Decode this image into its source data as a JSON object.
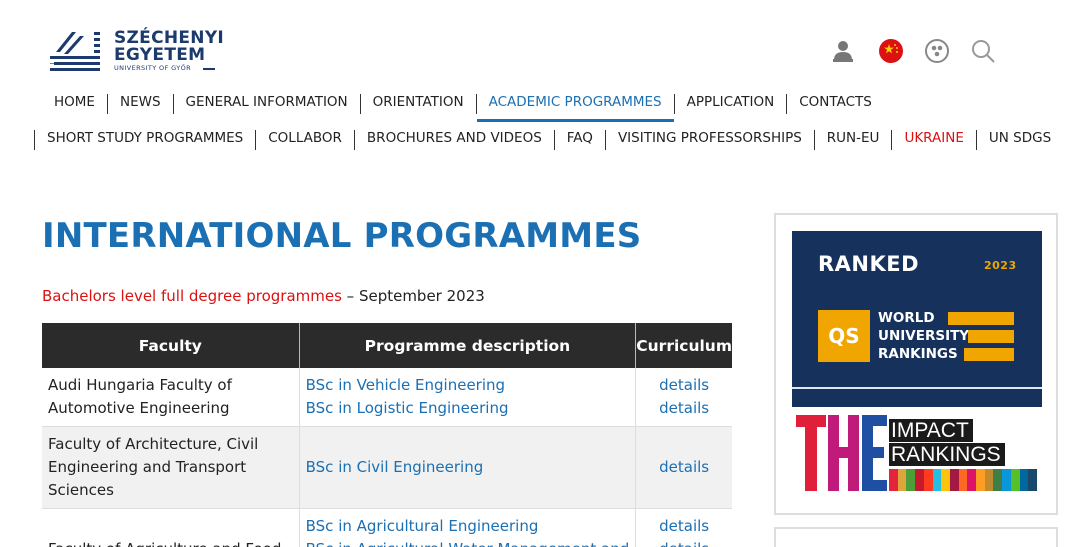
{
  "logo": {
    "line1": "SZÉCHENYI",
    "line2": "EGYETEM",
    "sub": "UNIVERSITY OF GYŐR"
  },
  "top_icons": [
    "user-icon",
    "chinese-flag-icon",
    "accessibility-icon",
    "search-icon"
  ],
  "nav_primary": [
    {
      "label": "HOME"
    },
    {
      "label": "NEWS"
    },
    {
      "label": "GENERAL INFORMATION"
    },
    {
      "label": "ORIENTATION"
    },
    {
      "label": "ACADEMIC PROGRAMMES",
      "active": true
    },
    {
      "label": "APPLICATION"
    },
    {
      "label": "CONTACTS"
    }
  ],
  "nav_secondary": [
    {
      "label": "SHORT STUDY PROGRAMMES"
    },
    {
      "label": "COLLABOR"
    },
    {
      "label": "BROCHURES AND VIDEOS"
    },
    {
      "label": "FAQ"
    },
    {
      "label": "VISITING PROFESSORSHIPS"
    },
    {
      "label": "RUN-EU"
    },
    {
      "label": "UKRAINE",
      "highlight": "#dd1111"
    },
    {
      "label": "UN SDGS"
    }
  ],
  "main": {
    "title": "INTERNATIONAL PROGRAMMES",
    "subtitle_link": "Bachelors level full degree programmes",
    "subtitle_rest": " – September 2023"
  },
  "table": {
    "headers": [
      "Faculty",
      "Programme description",
      "Curriculum"
    ],
    "rows": [
      {
        "faculty": "Audi Hungaria Faculty of Automotive Engineering",
        "programmes": [
          "BSc in Vehicle Engineering",
          "BSc in Logistic Engineering"
        ],
        "curriculum": [
          "details",
          "details"
        ]
      },
      {
        "faculty": "Faculty of Architecture, Civil Engineering and Transport Sciences",
        "programmes": [
          "BSc in Civil Engineering"
        ],
        "curriculum": [
          "details"
        ]
      },
      {
        "faculty": "Faculty of Agriculture and Food",
        "programmes": [
          "BSc in Agricultural Engineering",
          "BSc in Agricultural Water Management and"
        ],
        "curriculum": [
          "details",
          "details"
        ]
      }
    ]
  },
  "sidebar": {
    "qs": {
      "ranked": "RANKED",
      "year": "2023",
      "logo": "QS",
      "lines": [
        "WORLD",
        "UNIVERSITY",
        "RANKINGS"
      ]
    },
    "the": {
      "letters": "THE",
      "line1": "IMPACT",
      "line2": "RANKINGS"
    }
  },
  "colors": {
    "accent": "#1b6fb3",
    "red": "#dd1111",
    "qs_bg": "#16325c",
    "qs_gold": "#f0a500",
    "header_dark": "#2b2b2b"
  }
}
